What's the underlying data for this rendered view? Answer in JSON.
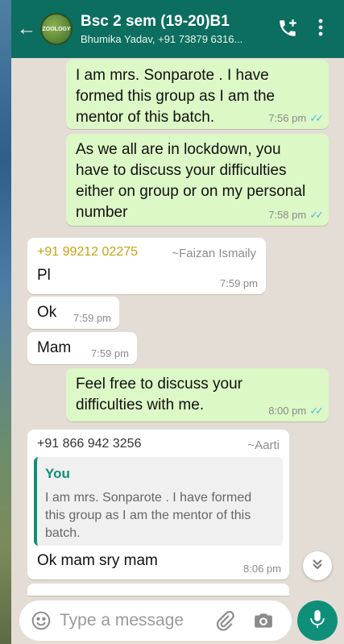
{
  "header": {
    "back_icon": "arrow-left-icon",
    "avatar_text": "ZOOLOGY",
    "title": "Bsc 2 sem (19-20)B1",
    "subtitle": "Bhumika Yadav, +91 73879 6316...",
    "call_icon": "add-call-icon",
    "menu_icon": "more-vertical-icon",
    "color": "#0b6e5e"
  },
  "messages": [
    {
      "direction": "out",
      "text": "I am mrs. Sonparote . I have formed this group as I am the mentor of this batch.",
      "time": "7:56 pm",
      "status": "read"
    },
    {
      "direction": "out",
      "text": "As we all are in lockdown, you have to discuss your difficulties either on group or on my personal number",
      "time": "7:58 pm",
      "status": "read"
    },
    {
      "direction": "in",
      "sender_number": "+91 99212 02275",
      "sender_name": "~Faizan Ismaily",
      "text": "Pl",
      "time": "7:59 pm"
    },
    {
      "direction": "in",
      "text": "Ok",
      "time": "7:59 pm"
    },
    {
      "direction": "in",
      "text": "Mam",
      "time": "7:59 pm"
    },
    {
      "direction": "out",
      "text": "Feel free to discuss your difficulties with me.",
      "time": "8:00 pm",
      "status": "read"
    },
    {
      "direction": "in",
      "sender_number": "+91 866 942 3256",
      "sender_name": "~Aarti",
      "quote_author": "You",
      "quote_text": "I am mrs. Sonparote . I have formed this group as I am the mentor of this batch.",
      "text": "Ok mam sry mam",
      "time": "8:06 pm"
    }
  ],
  "composer": {
    "placeholder": "Type a message",
    "emoji_icon": "emoji-icon",
    "attach_icon": "paperclip-icon",
    "camera_icon": "camera-icon",
    "mic_icon": "microphone-icon",
    "accent": "#0f8f7a"
  },
  "colors": {
    "outgoing_bubble": "#dcf8c6",
    "incoming_bubble": "#ffffff",
    "chat_background": "#e3ddd5",
    "read_ticks": "#4fb6ec"
  }
}
